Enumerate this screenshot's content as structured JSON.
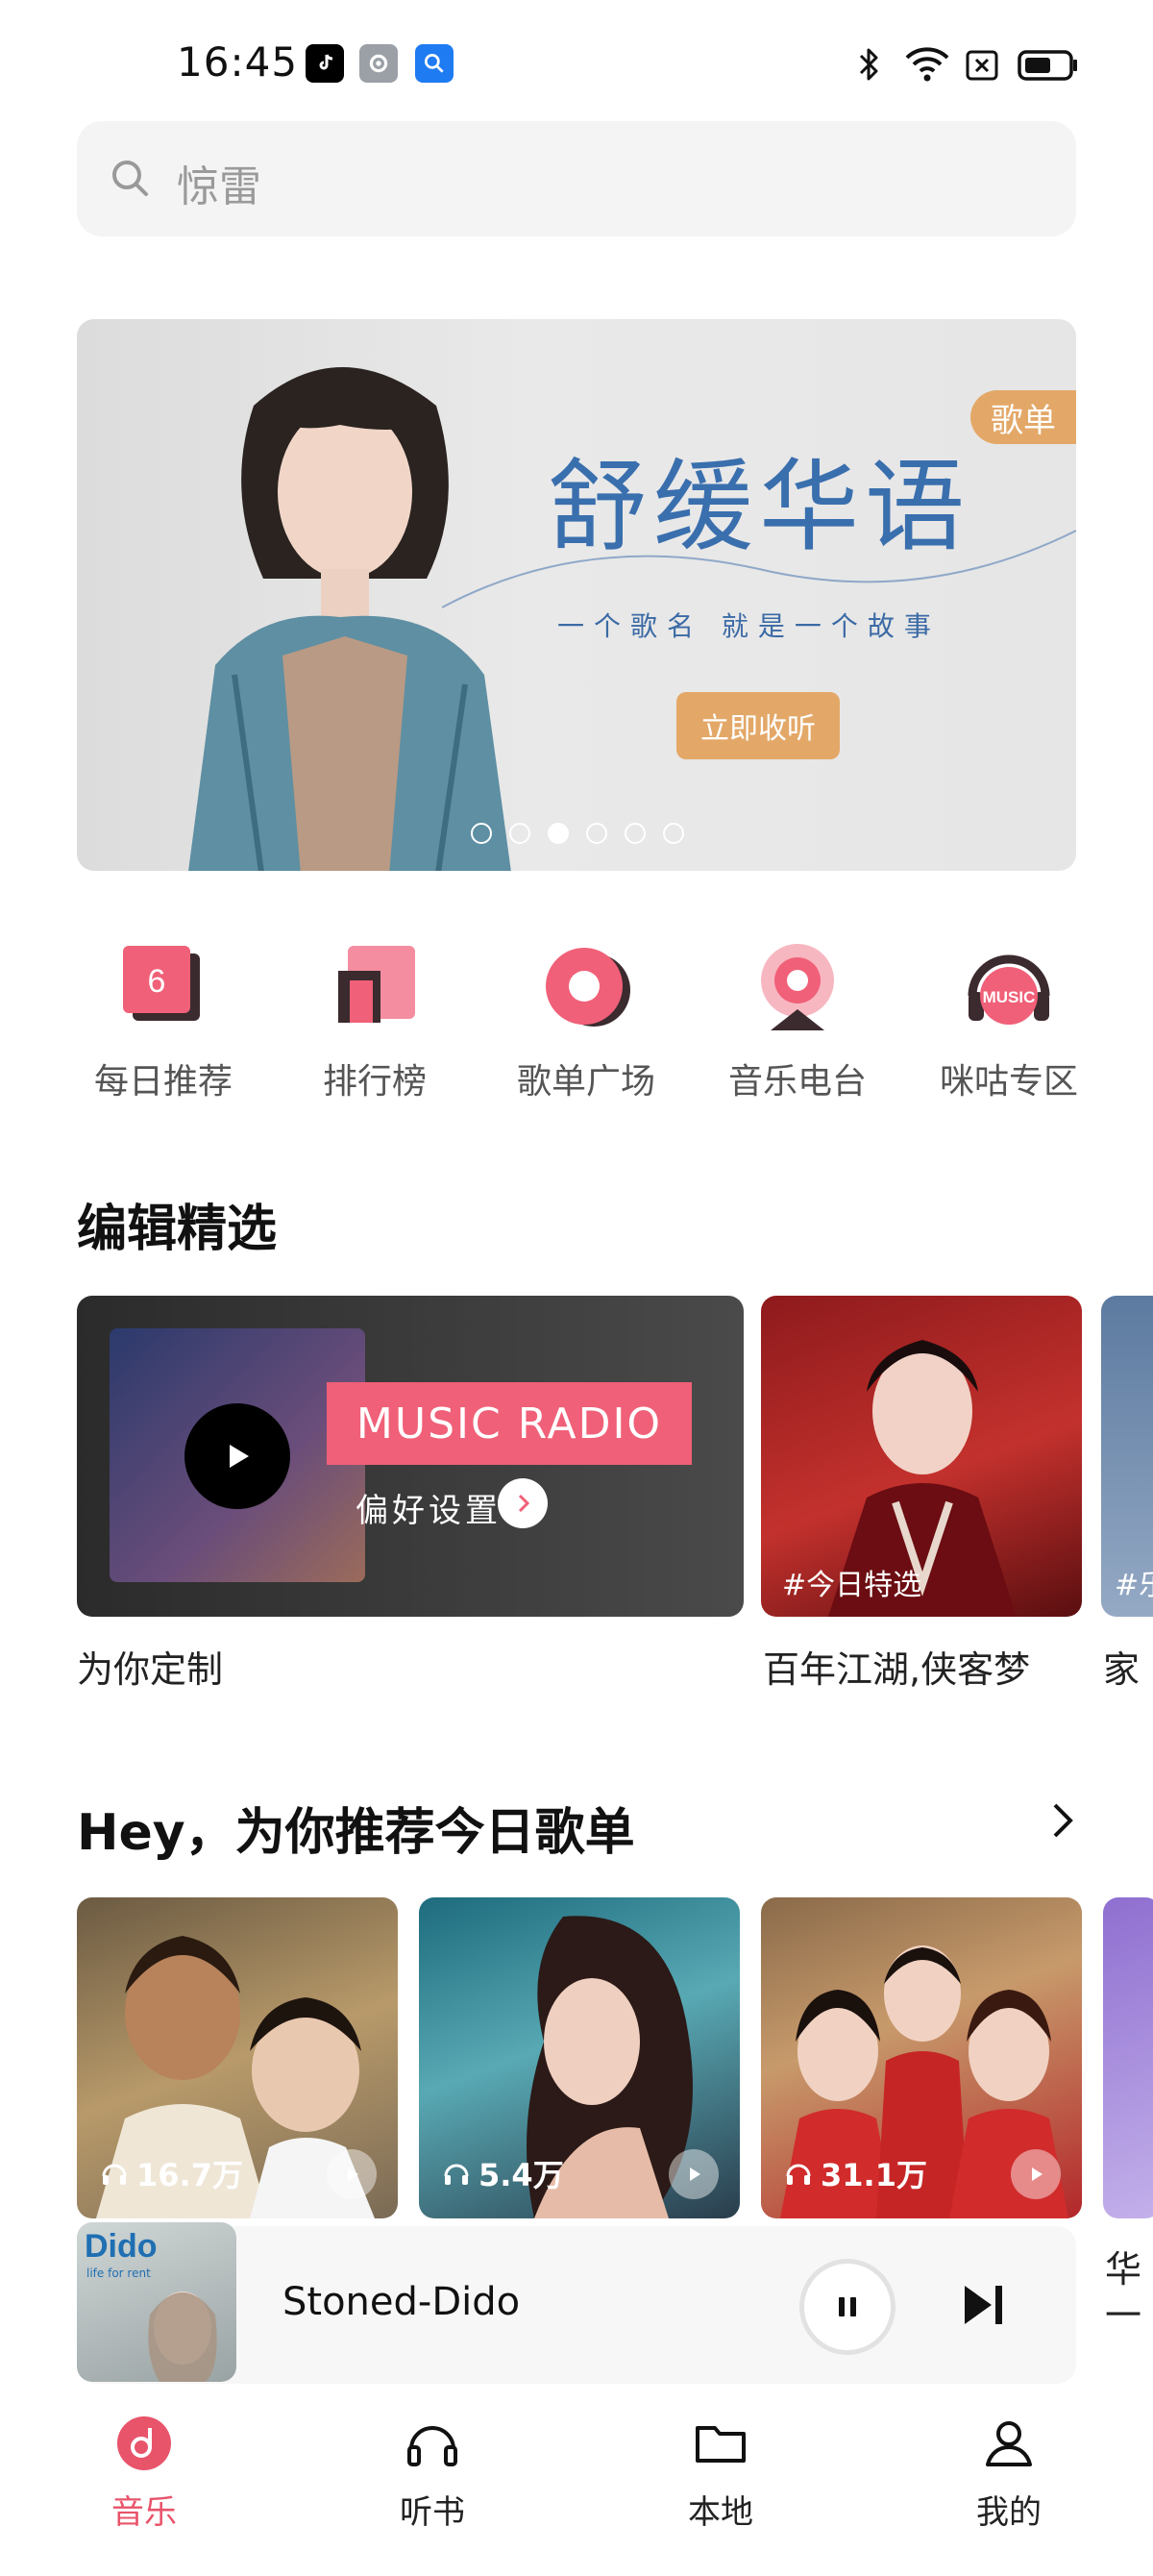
{
  "status": {
    "time": "16:45"
  },
  "search": {
    "placeholder": "惊雷"
  },
  "banner": {
    "tag": "歌单",
    "headline": "舒缓华语",
    "subline": "一个歌名  就是一个故事",
    "cta": "立即收听",
    "active_dot": 3,
    "dot_count": 6
  },
  "quicknav": {
    "items": [
      {
        "label": "每日推荐",
        "icon": "calendar-6-icon",
        "badge": "6"
      },
      {
        "label": "排行榜",
        "icon": "chart-icon"
      },
      {
        "label": "歌单广场",
        "icon": "playlist-disc-icon"
      },
      {
        "label": "音乐电台",
        "icon": "radio-icon"
      },
      {
        "label": "咪咕专区",
        "icon": "headphones-music-icon",
        "badge": "MUSIC"
      }
    ]
  },
  "editor": {
    "title": "编辑精选",
    "cards": [
      {
        "title": "为你定制",
        "radio_label": "MUSIC RADIO",
        "pref_label": "偏好设置"
      },
      {
        "title": "百年江湖,侠客梦",
        "chip": "#今日特选"
      },
      {
        "title": "家",
        "chip": "#乐"
      }
    ]
  },
  "playlists": {
    "title": "Hey，为你推荐今日歌单",
    "items": [
      {
        "count": "16.7万"
      },
      {
        "count": "5.4万"
      },
      {
        "count": "31.1万"
      }
    ],
    "partial_label": "华",
    "partial_sub": "一"
  },
  "player": {
    "song": "Stoned-Dido",
    "cover_title": "Dido",
    "cover_sub": "life for rent"
  },
  "tabbar": {
    "tabs": [
      {
        "label": "音乐",
        "active": true
      },
      {
        "label": "听书"
      },
      {
        "label": "本地"
      },
      {
        "label": "我的"
      }
    ]
  },
  "colors": {
    "accent": "#e8546a",
    "banner_blue": "#3a6fae",
    "banner_orange": "#e3a868"
  }
}
